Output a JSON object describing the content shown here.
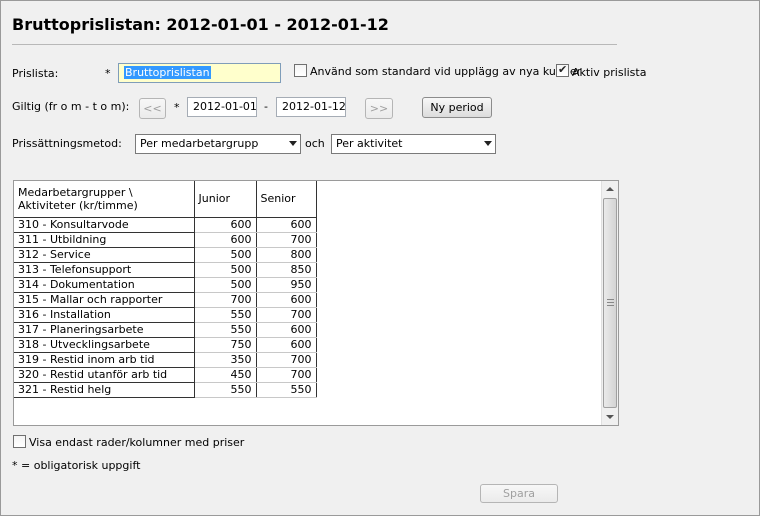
{
  "page": {
    "title": "Bruttoprislistan: 2012-01-01 - 2012-01-12"
  },
  "form": {
    "prislista_label": "Prislista:",
    "required_mark": "*",
    "prislista_value": "Bruttoprislistan",
    "standard_checkbox_label": "Använd som standard vid upplägg av nya kunder",
    "standard_checked": false,
    "aktiv_checkbox_label": "Aktiv prislista",
    "aktiv_checked": true,
    "giltig_label": "Giltig (fr o m - t o m):",
    "prev_button": "<<",
    "from_date": "2012-01-01",
    "date_separator": "-",
    "to_date": "2012-01-12",
    "next_button": ">>",
    "ny_period_button": "Ny period",
    "metod_label": "Prissättningsmetod:",
    "metod_select_1": "Per medarbetargrupp",
    "och_label": "och",
    "metod_select_2": "Per aktivitet"
  },
  "grid": {
    "header_name": "Medarbetargrupper \\ Aktiviteter (kr/timme)",
    "header_name_line1": "Medarbetargrupper \\",
    "header_name_line2": "Aktiviteter (kr/timme)",
    "columns": [
      "Junior",
      "Senior"
    ],
    "rows": [
      {
        "name": "310 - Konsultarvode",
        "junior": "600",
        "senior": "600"
      },
      {
        "name": "311 - Utbildning",
        "junior": "600",
        "senior": "700"
      },
      {
        "name": "312 - Service",
        "junior": "500",
        "senior": "800"
      },
      {
        "name": "313 - Telefonsupport",
        "junior": "500",
        "senior": "850"
      },
      {
        "name": "314 - Dokumentation",
        "junior": "500",
        "senior": "950"
      },
      {
        "name": "315 - Mallar och rapporter",
        "junior": "700",
        "senior": "600"
      },
      {
        "name": "316 - Installation",
        "junior": "550",
        "senior": "700"
      },
      {
        "name": "317 - Planeringsarbete",
        "junior": "550",
        "senior": "600"
      },
      {
        "name": "318 - Utvecklingsarbete",
        "junior": "750",
        "senior": "600"
      },
      {
        "name": "319 - Restid inom arb tid",
        "junior": "350",
        "senior": "700"
      },
      {
        "name": "320 - Restid utanför arb tid",
        "junior": "450",
        "senior": "700"
      },
      {
        "name": "321 - Restid helg",
        "junior": "550",
        "senior": "550"
      }
    ]
  },
  "footer": {
    "visa_endast_label": "Visa endast rader/kolumner med priser",
    "visa_endast_checked": false,
    "required_note": "* = obligatorisk uppgift",
    "spara_button": "Spara"
  }
}
